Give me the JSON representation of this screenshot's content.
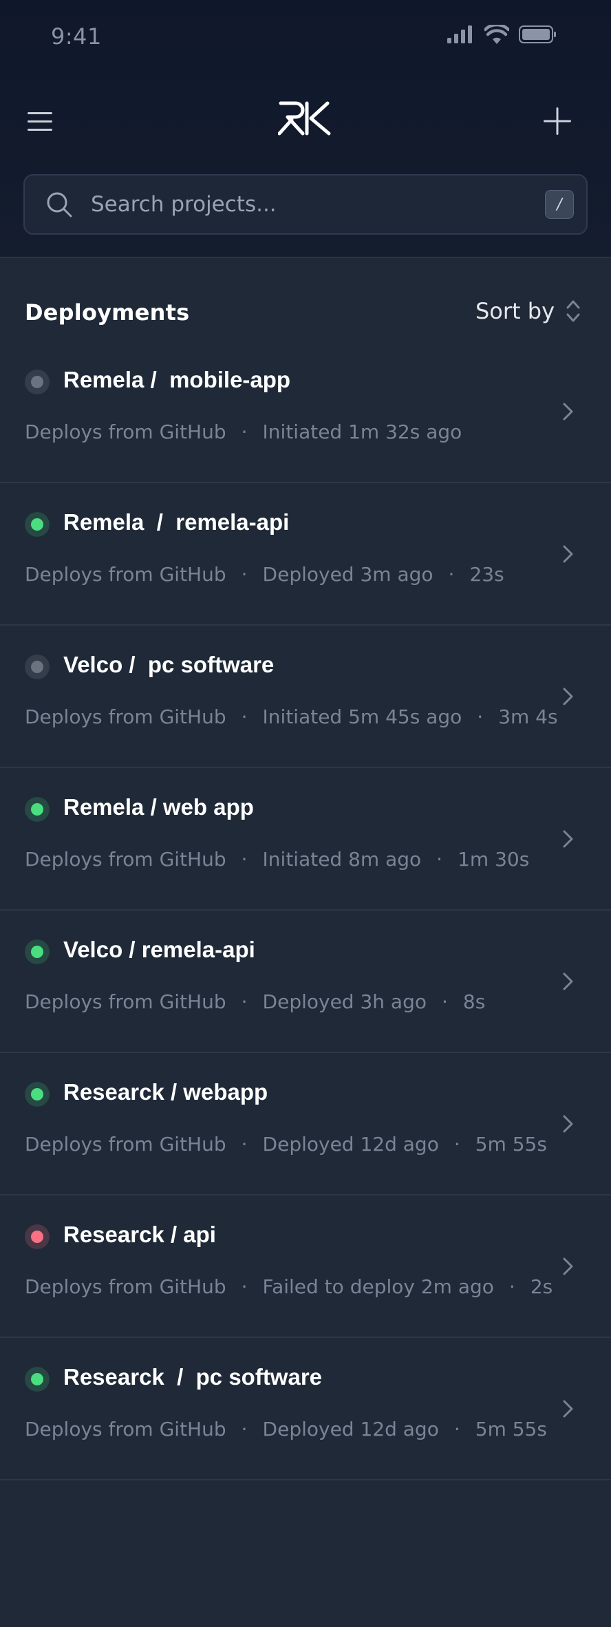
{
  "status_bar": {
    "time": "9:41"
  },
  "header": {
    "menu_icon": "hamburger-menu-icon",
    "logo_text": "RK",
    "add_icon": "plus-icon"
  },
  "search": {
    "placeholder": "Search projects...",
    "value": "",
    "shortcut": "/"
  },
  "section": {
    "title": "Deployments",
    "sort_label": "Sort by"
  },
  "colors": {
    "idle": "#6b7280",
    "success": "#4ade80",
    "failed": "#f87184"
  },
  "deployments": [
    {
      "status": "idle",
      "title": "Remela /  mobile-app",
      "source": "Deploys from GitHub",
      "event": "Initiated 1m 32s ago",
      "duration": ""
    },
    {
      "status": "success",
      "title": "Remela  /  remela-api",
      "source": "Deploys from GitHub",
      "event": "Deployed 3m ago",
      "duration": "23s"
    },
    {
      "status": "idle",
      "title": "Velco /  pc software",
      "source": "Deploys from GitHub",
      "event": "Initiated 5m 45s ago",
      "duration": "3m 4s"
    },
    {
      "status": "success",
      "title": "Remela / web app",
      "source": "Deploys from GitHub",
      "event": "Initiated 8m ago",
      "duration": "1m 30s"
    },
    {
      "status": "success",
      "title": "Velco / remela-api",
      "source": "Deploys from GitHub",
      "event": "Deployed 3h ago",
      "duration": "8s"
    },
    {
      "status": "success",
      "title": "Researck / webapp",
      "source": "Deploys from GitHub",
      "event": "Deployed 12d ago",
      "duration": "5m 55s"
    },
    {
      "status": "failed",
      "title": "Researck / api",
      "source": "Deploys from GitHub",
      "event": "Failed to deploy 2m ago",
      "duration": "2s"
    },
    {
      "status": "success",
      "title": "Researck  /  pc software",
      "source": "Deploys from GitHub",
      "event": "Deployed 12d ago",
      "duration": "5m 55s"
    }
  ]
}
